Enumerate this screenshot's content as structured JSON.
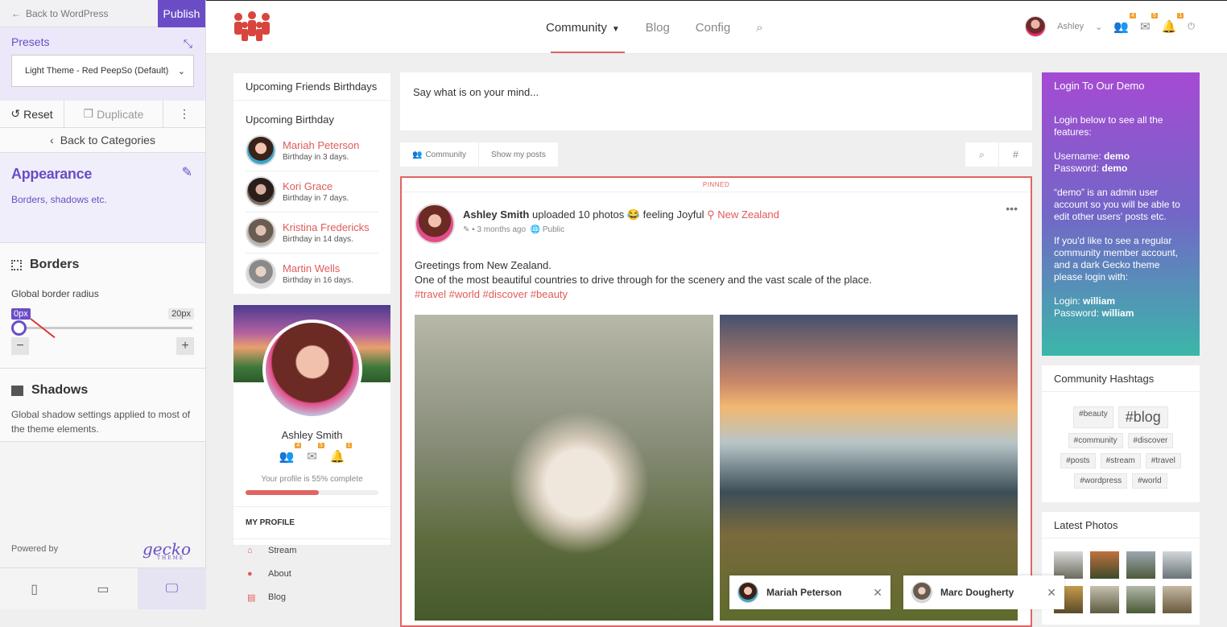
{
  "sidebar": {
    "back_label": "Back to WordPress",
    "publish_label": "Publish",
    "presets_label": "Presets",
    "preset_value": "Light Theme - Red PeepSo (Default)",
    "reset_label": "Reset",
    "duplicate_label": "Duplicate",
    "back_categories": "Back to Categories",
    "appearance_title": "Appearance",
    "appearance_sub": "Borders, shadows etc.",
    "borders_title": "Borders",
    "border_radius_label": "Global border radius",
    "border_radius_value": "0px",
    "border_radius_max": "20px",
    "shadows_title": "Shadows",
    "shadows_desc": "Global shadow settings applied to most of the theme elements.",
    "powered_by": "Powered by",
    "gecko_logo": "gecko",
    "gecko_logo_sub": "THEME"
  },
  "topnav": {
    "items": [
      "Community",
      "Blog",
      "Config"
    ],
    "user_name": "Ashley",
    "friends_count": "4",
    "messages_count": "5",
    "notifications_count": "1"
  },
  "birthdays": {
    "title": "Upcoming Friends Birthdays",
    "subtitle": "Upcoming Birthday",
    "people": [
      {
        "name": "Mariah Peterson",
        "when": "Birthday in 3 days."
      },
      {
        "name": "Kori Grace",
        "when": "Birthday in 7 days."
      },
      {
        "name": "Kristina Fredericks",
        "when": "Birthday in 14 days."
      },
      {
        "name": "Martin Wells",
        "when": "Birthday in 16 days."
      }
    ]
  },
  "profile": {
    "name": "Ashley Smith",
    "friends": "4",
    "messages": "5",
    "notifications": "1",
    "completion_text": "Your profile is 55% complete",
    "completion": 0.55,
    "my_profile": "MY PROFILE",
    "menu": [
      "Stream",
      "About",
      "Blog"
    ]
  },
  "feed": {
    "placeholder": "Say what is on your mind...",
    "tab_community": "Community",
    "tab_my_posts": "Show my posts",
    "pinned": "PINNED",
    "post": {
      "author": "Ashley Smith",
      "action": "uploaded 10 photos 😂 feeling Joyful",
      "location": "New Zealand",
      "time": "3 months ago",
      "privacy": "Public",
      "line1": "Greetings from New Zealand.",
      "line2": "One of the most beautiful countries to drive through for the scenery and the vast scale of the place.",
      "tags": "#travel #world #discover #beauty"
    }
  },
  "login_box": {
    "title": "Login To Our Demo",
    "intro": "Login below to see all the features:",
    "username_label": "Username:",
    "username": "demo",
    "password_label": "Password:",
    "password": "demo",
    "admin_note": "“demo” is an admin user account so you will be able to edit other users' posts etc.",
    "regular_note": "If you'd like to see a regular community member account, and a dark Gecko theme please login with:",
    "login_label": "Login:",
    "login2": "william",
    "password2_label": "Password:",
    "password2": "william"
  },
  "hashtags": {
    "title": "Community Hashtags",
    "tags": [
      "#beauty",
      "#blog",
      "#community",
      "#discover",
      "#posts",
      "#stream",
      "#travel",
      "#wordpress",
      "#world"
    ]
  },
  "latest_photos": {
    "title": "Latest Photos"
  },
  "chats": [
    {
      "name": "Mariah Peterson"
    },
    {
      "name": "Marc Dougherty"
    }
  ]
}
